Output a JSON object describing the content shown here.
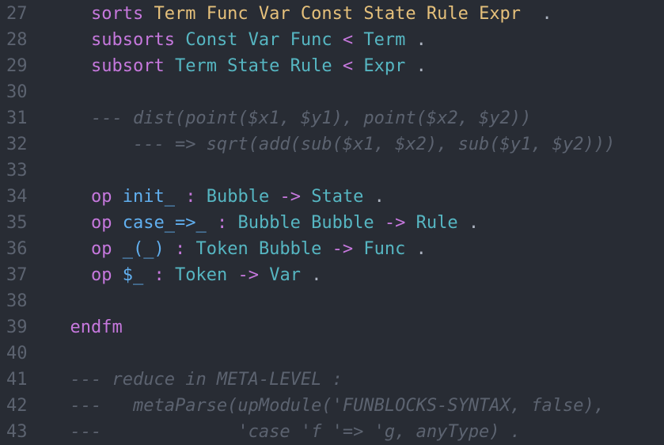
{
  "editor": {
    "lines": [
      {
        "num": "27",
        "tokens": [
          {
            "t": "    ",
            "c": "txt"
          },
          {
            "t": "sorts",
            "c": "kw"
          },
          {
            "t": " ",
            "c": "txt"
          },
          {
            "t": "Term Func Var Const State Rule Expr",
            "c": "yel"
          },
          {
            "t": "  .",
            "c": "txt"
          }
        ]
      },
      {
        "num": "28",
        "tokens": [
          {
            "t": "    ",
            "c": "txt"
          },
          {
            "t": "subsorts",
            "c": "kw"
          },
          {
            "t": " ",
            "c": "txt"
          },
          {
            "t": "Const Var Func",
            "c": "cyan"
          },
          {
            "t": " ",
            "c": "txt"
          },
          {
            "t": "<",
            "c": "kw"
          },
          {
            "t": " ",
            "c": "txt"
          },
          {
            "t": "Term",
            "c": "cyan"
          },
          {
            "t": " .",
            "c": "txt"
          }
        ]
      },
      {
        "num": "29",
        "tokens": [
          {
            "t": "    ",
            "c": "txt"
          },
          {
            "t": "subsort",
            "c": "kw"
          },
          {
            "t": " ",
            "c": "txt"
          },
          {
            "t": "Term State Rule",
            "c": "cyan"
          },
          {
            "t": " ",
            "c": "txt"
          },
          {
            "t": "<",
            "c": "kw"
          },
          {
            "t": " ",
            "c": "txt"
          },
          {
            "t": "Expr",
            "c": "cyan"
          },
          {
            "t": " .",
            "c": "txt"
          }
        ]
      },
      {
        "num": "30",
        "tokens": []
      },
      {
        "num": "31",
        "tokens": [
          {
            "t": "    ",
            "c": "txt"
          },
          {
            "t": "--- dist(point($x1, $y1), point($x2, $y2))",
            "c": "cmt"
          }
        ]
      },
      {
        "num": "32",
        "tokens": [
          {
            "t": "        ",
            "c": "txt"
          },
          {
            "t": "--- => sqrt(add(sub($x1, $x2), sub($y1, $y2)))",
            "c": "cmt"
          }
        ]
      },
      {
        "num": "33",
        "tokens": []
      },
      {
        "num": "34",
        "tokens": [
          {
            "t": "    ",
            "c": "txt"
          },
          {
            "t": "op",
            "c": "kw"
          },
          {
            "t": " ",
            "c": "txt"
          },
          {
            "t": "init_",
            "c": "blue"
          },
          {
            "t": " ",
            "c": "txt"
          },
          {
            "t": ":",
            "c": "kw"
          },
          {
            "t": " ",
            "c": "txt"
          },
          {
            "t": "Bubble",
            "c": "cyan"
          },
          {
            "t": " ",
            "c": "txt"
          },
          {
            "t": "->",
            "c": "kw"
          },
          {
            "t": " ",
            "c": "txt"
          },
          {
            "t": "State",
            "c": "cyan"
          },
          {
            "t": " .",
            "c": "txt"
          }
        ]
      },
      {
        "num": "35",
        "tokens": [
          {
            "t": "    ",
            "c": "txt"
          },
          {
            "t": "op",
            "c": "kw"
          },
          {
            "t": " ",
            "c": "txt"
          },
          {
            "t": "case_=>_",
            "c": "blue"
          },
          {
            "t": " ",
            "c": "txt"
          },
          {
            "t": ":",
            "c": "kw"
          },
          {
            "t": " ",
            "c": "txt"
          },
          {
            "t": "Bubble Bubble",
            "c": "cyan"
          },
          {
            "t": " ",
            "c": "txt"
          },
          {
            "t": "->",
            "c": "kw"
          },
          {
            "t": " ",
            "c": "txt"
          },
          {
            "t": "Rule",
            "c": "cyan"
          },
          {
            "t": " .",
            "c": "txt"
          }
        ]
      },
      {
        "num": "36",
        "tokens": [
          {
            "t": "    ",
            "c": "txt"
          },
          {
            "t": "op",
            "c": "kw"
          },
          {
            "t": " ",
            "c": "txt"
          },
          {
            "t": "_(_)",
            "c": "blue"
          },
          {
            "t": " ",
            "c": "txt"
          },
          {
            "t": ":",
            "c": "kw"
          },
          {
            "t": " ",
            "c": "txt"
          },
          {
            "t": "Token Bubble",
            "c": "cyan"
          },
          {
            "t": " ",
            "c": "txt"
          },
          {
            "t": "->",
            "c": "kw"
          },
          {
            "t": " ",
            "c": "txt"
          },
          {
            "t": "Func",
            "c": "cyan"
          },
          {
            "t": " .",
            "c": "txt"
          }
        ]
      },
      {
        "num": "37",
        "tokens": [
          {
            "t": "    ",
            "c": "txt"
          },
          {
            "t": "op",
            "c": "kw"
          },
          {
            "t": " ",
            "c": "txt"
          },
          {
            "t": "$_",
            "c": "blue"
          },
          {
            "t": " ",
            "c": "txt"
          },
          {
            "t": ":",
            "c": "kw"
          },
          {
            "t": " ",
            "c": "txt"
          },
          {
            "t": "Token",
            "c": "cyan"
          },
          {
            "t": " ",
            "c": "txt"
          },
          {
            "t": "->",
            "c": "kw"
          },
          {
            "t": " ",
            "c": "txt"
          },
          {
            "t": "Var",
            "c": "cyan"
          },
          {
            "t": " .",
            "c": "txt"
          }
        ]
      },
      {
        "num": "38",
        "tokens": []
      },
      {
        "num": "39",
        "tokens": [
          {
            "t": "  ",
            "c": "txt"
          },
          {
            "t": "endfm",
            "c": "kw"
          }
        ]
      },
      {
        "num": "40",
        "tokens": []
      },
      {
        "num": "41",
        "tokens": [
          {
            "t": "  ",
            "c": "txt"
          },
          {
            "t": "--- reduce in META-LEVEL :",
            "c": "cmt"
          }
        ]
      },
      {
        "num": "42",
        "tokens": [
          {
            "t": "  ",
            "c": "txt"
          },
          {
            "t": "---   metaParse(upModule('FUNBLOCKS-SYNTAX, false),",
            "c": "cmt"
          }
        ]
      },
      {
        "num": "43",
        "tokens": [
          {
            "t": "  ",
            "c": "txt"
          },
          {
            "t": "---             'case 'f '=> 'g, anyType) .",
            "c": "cmt"
          }
        ]
      }
    ]
  },
  "colors": {
    "background": "#282c34",
    "line_number": "#5c6370",
    "keyword": "#c678dd",
    "sort_name": "#e5c07b",
    "type_name": "#56b6c2",
    "op_name": "#61afef",
    "plain": "#abb2bf",
    "comment": "#5c6370"
  }
}
